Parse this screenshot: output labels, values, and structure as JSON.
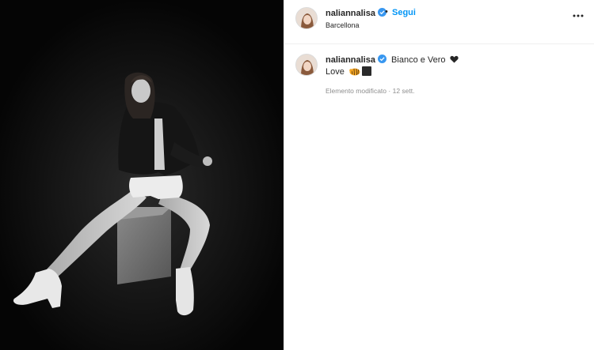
{
  "post": {
    "username": "naliannalisa",
    "location": "Barcellona",
    "follow_label": "Segui",
    "separator": "•",
    "caption_title": "Bianco e Vero",
    "caption_body": "Love",
    "edited_label": "Elemento modificato",
    "meta_separator": "·",
    "date": "12 sett."
  },
  "icons": {
    "verified": "verified-badge-icon",
    "more": "more-options-icon",
    "heart": "black-heart-icon",
    "tiger": "tiger-emoji-icon",
    "square": "black-square-emoji-icon"
  },
  "colors": {
    "accent": "#0095f6",
    "text": "#262626",
    "muted": "#8e8e8e",
    "photo_bg": "#060606"
  }
}
